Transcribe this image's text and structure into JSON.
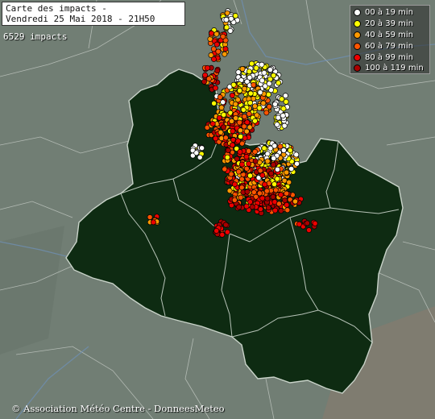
{
  "title": {
    "line1": "Carte des impacts -",
    "line2": "Vendredi 25 Mai 2018 - 21H50"
  },
  "impact_count": "6529 impacts",
  "legend": [
    {
      "label": "00 à 19 min",
      "color": "#ffffff"
    },
    {
      "label": "20 à 39 min",
      "color": "#ffff00"
    },
    {
      "label": "40 à 59 min",
      "color": "#ff9900"
    },
    {
      "label": "60 à 79 min",
      "color": "#ff5500"
    },
    {
      "label": "80 à 99 min",
      "color": "#ee0000"
    },
    {
      "label": "100 à 119 min",
      "color": "#aa0000"
    }
  ],
  "copyright": "© Association Météo Centre - DonneesMeteo"
}
